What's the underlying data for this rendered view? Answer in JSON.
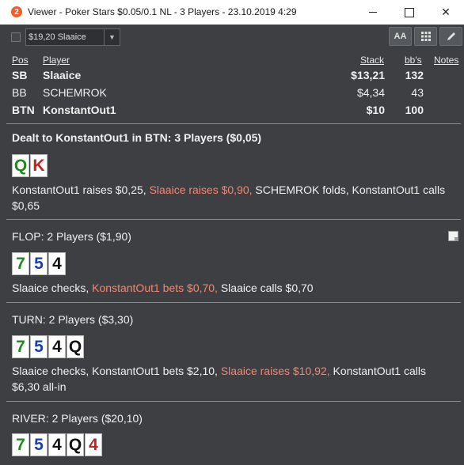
{
  "window": {
    "app_icon": "2",
    "title": "Viewer - Poker Stars $0.05/0.1 NL - 3 Players - 23.10.2019 4:29",
    "close_glyph": "✕"
  },
  "toolbar": {
    "selected_player": "$19,20 Slaaice",
    "font_label": "AA",
    "grid_icon": "grid-icon",
    "edit_icon": "pencil-icon"
  },
  "players": {
    "headers": {
      "pos": "Pos",
      "player": "Player",
      "stack": "Stack",
      "bbs": "bb's",
      "notes": "Notes"
    },
    "rows": [
      {
        "pos": "SB",
        "name": "Slaaice",
        "stack": "$13,21",
        "bbs": "132",
        "bold": true
      },
      {
        "pos": "BB",
        "name": "SCHEMROK",
        "stack": "$4,34",
        "bbs": "43",
        "bold": false
      },
      {
        "pos": "BTN",
        "name": "KonstantOut1",
        "stack": "$10",
        "bbs": "100",
        "bold": true
      }
    ]
  },
  "preflop": {
    "title": "Dealt to KonstantOut1 in BTN: 3 Players ($0,05)",
    "cards": [
      {
        "rank": "Q",
        "suit_color": "#1e8a1e"
      },
      {
        "rank": "K",
        "suit_color": "#c42020"
      }
    ],
    "a1": "KonstantOut1 raises $0,25, ",
    "a2": "Slaaice raises $0,90, ",
    "a3": "SCHEMROK folds, KonstantOut1 calls $0,65"
  },
  "flop": {
    "title": "FLOP: 2 Players ($1,90)",
    "cards": [
      {
        "rank": "7",
        "suit_color": "#1e8a1e"
      },
      {
        "rank": "5",
        "suit_color": "#1a3fb0"
      },
      {
        "rank": "4",
        "suit_color": "#111111"
      }
    ],
    "a1": "Slaaice checks, ",
    "a2": "KonstantOut1 bets $0,70, ",
    "a3": "Slaaice calls $0,70"
  },
  "turn": {
    "title": "TURN: 2 Players ($3,30)",
    "cards": [
      {
        "rank": "7",
        "suit_color": "#1e8a1e"
      },
      {
        "rank": "5",
        "suit_color": "#1a3fb0"
      },
      {
        "rank": "4",
        "suit_color": "#111111"
      },
      {
        "rank": "Q",
        "suit_color": "#111111"
      }
    ],
    "a1": "Slaaice checks, KonstantOut1 bets $2,10, ",
    "a2": "Slaaice raises $10,92, ",
    "a3": "KonstantOut1 calls $6,30 all-in"
  },
  "river": {
    "title": "RIVER: 2 Players ($20,10)",
    "cards": [
      {
        "rank": "7",
        "suit_color": "#1e8a1e"
      },
      {
        "rank": "5",
        "suit_color": "#1a3fb0"
      },
      {
        "rank": "4",
        "suit_color": "#111111"
      },
      {
        "rank": "Q",
        "suit_color": "#111111"
      },
      {
        "rank": "4",
        "suit_color": "#c42020"
      }
    ]
  }
}
